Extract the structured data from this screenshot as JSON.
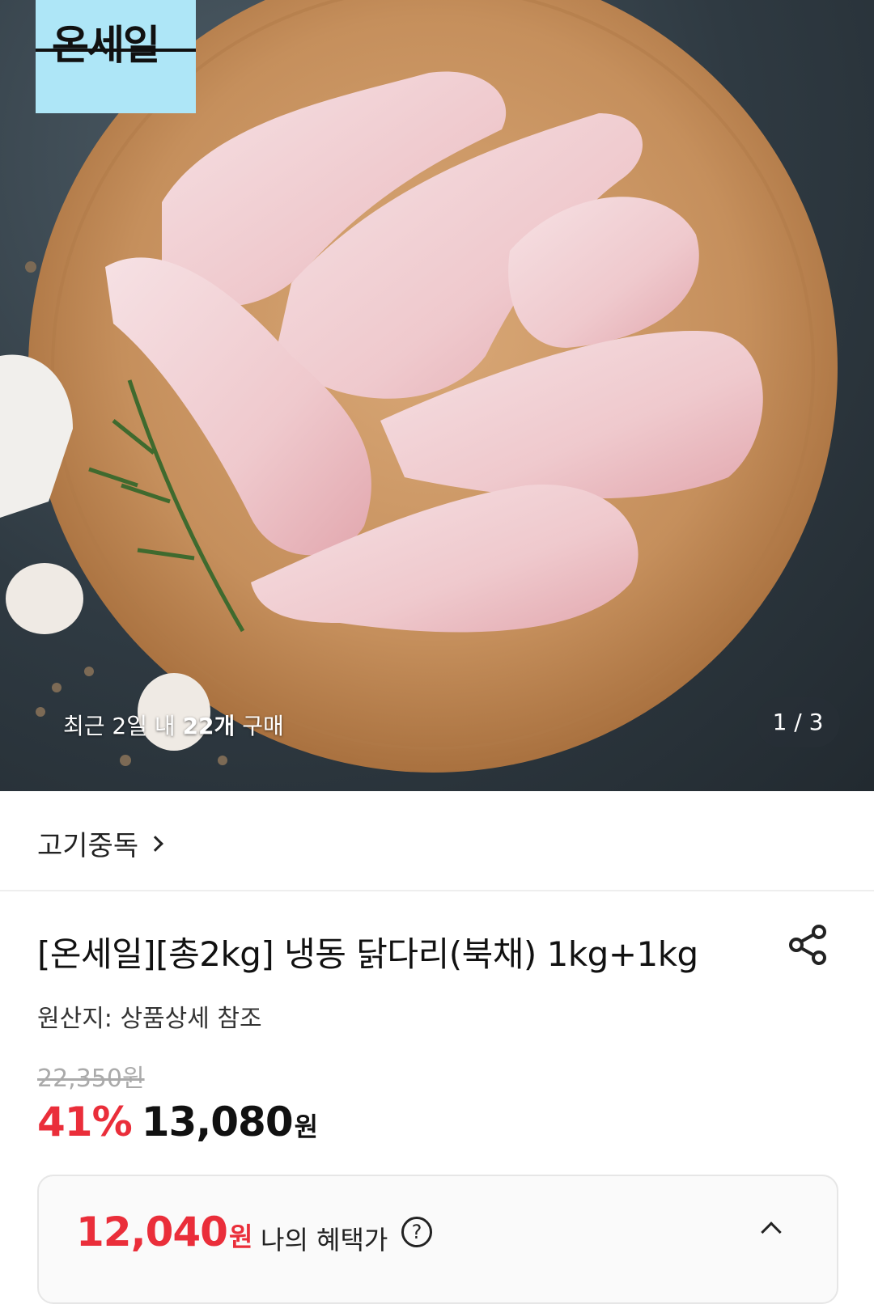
{
  "hero": {
    "brand_badge": "온세일",
    "recent_prefix": "최근 2일 내 ",
    "recent_count": "22개",
    "recent_suffix": " 구매",
    "page_indicator": "1 / 3",
    "image_subject": "raw chicken drumsticks on wooden board"
  },
  "seller": {
    "name": "고기중독"
  },
  "product": {
    "title": "[온세일][총2kg] 냉동 닭다리(북채) 1kg+1kg",
    "origin": "원산지: 상품상세 참조",
    "original_price": "22,350원",
    "discount": "41%",
    "sale_price": "13,080",
    "price_unit": "원"
  },
  "benefit": {
    "amount": "12,040",
    "unit": "원",
    "label": "나의 혜택가",
    "help_glyph": "?"
  },
  "colors": {
    "accent_red": "#ea2e3a",
    "badge_blue": "#aee6f7"
  }
}
